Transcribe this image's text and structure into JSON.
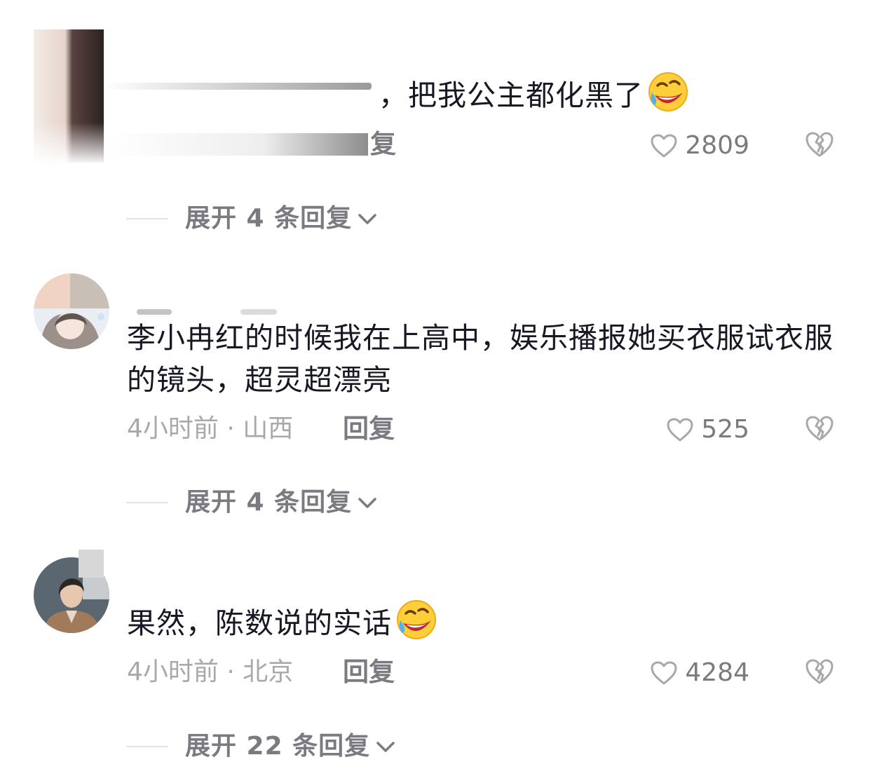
{
  "comments": [
    {
      "text": "，把我公主都化黑了",
      "emoji": "rofl-emoji",
      "meta_suffix": "复",
      "likes": "2809"
    },
    {
      "text": "李小冉红的时候我在上高中，娱乐播报她买衣服试衣服的镜头，超灵超漂亮",
      "time_location": "4小时前 · 山西",
      "reply_label": "回复",
      "likes": "525",
      "expand_label": "展开 4 条回复"
    },
    {
      "text": "果然，陈数说的实话",
      "emoji": "rofl-emoji",
      "time_location": "4小时前 · 北京",
      "reply_label": "回复",
      "likes": "4284",
      "expand_label": "展开 22 条回复"
    }
  ],
  "first_expand_label": "展开 4 条回复",
  "colors": {
    "text_primary": "#161823",
    "text_secondary": "#7a7a80",
    "text_meta": "#a8a8ad",
    "divider": "#e3e3e6"
  }
}
